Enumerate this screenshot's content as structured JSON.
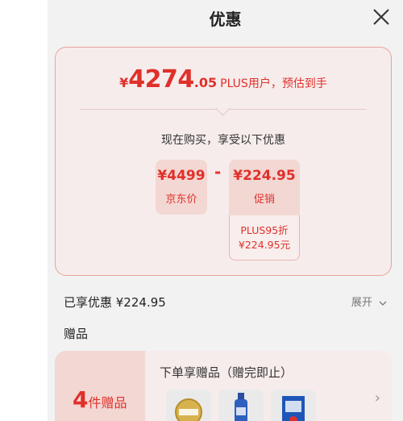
{
  "dialog": {
    "title": "优惠"
  },
  "price": {
    "yen": "¥",
    "integer": "4274",
    "decimal": ".05",
    "note": "PLUS用户，预估到手"
  },
  "breakdown": {
    "subtitle": "现在购买，享受以下优惠",
    "original": {
      "amount": "¥4499",
      "label": "京东价"
    },
    "operator": "-",
    "promotion": {
      "amount": "¥224.95",
      "label": "促销",
      "detail_line1": "PLUS95折",
      "detail_line2": "¥224.95元"
    }
  },
  "summary": {
    "enjoyed": "已享优惠 ¥224.95",
    "expand": "展开"
  },
  "gifts": {
    "heading": "赠品",
    "count": "4",
    "count_unit": "件赠品",
    "title": "下单享赠品（赠完即止）"
  },
  "colors": {
    "accent": "#e0302a",
    "sheet": "#f2f2f2",
    "card": "#f6eceb",
    "box": "#f3d7d3"
  }
}
